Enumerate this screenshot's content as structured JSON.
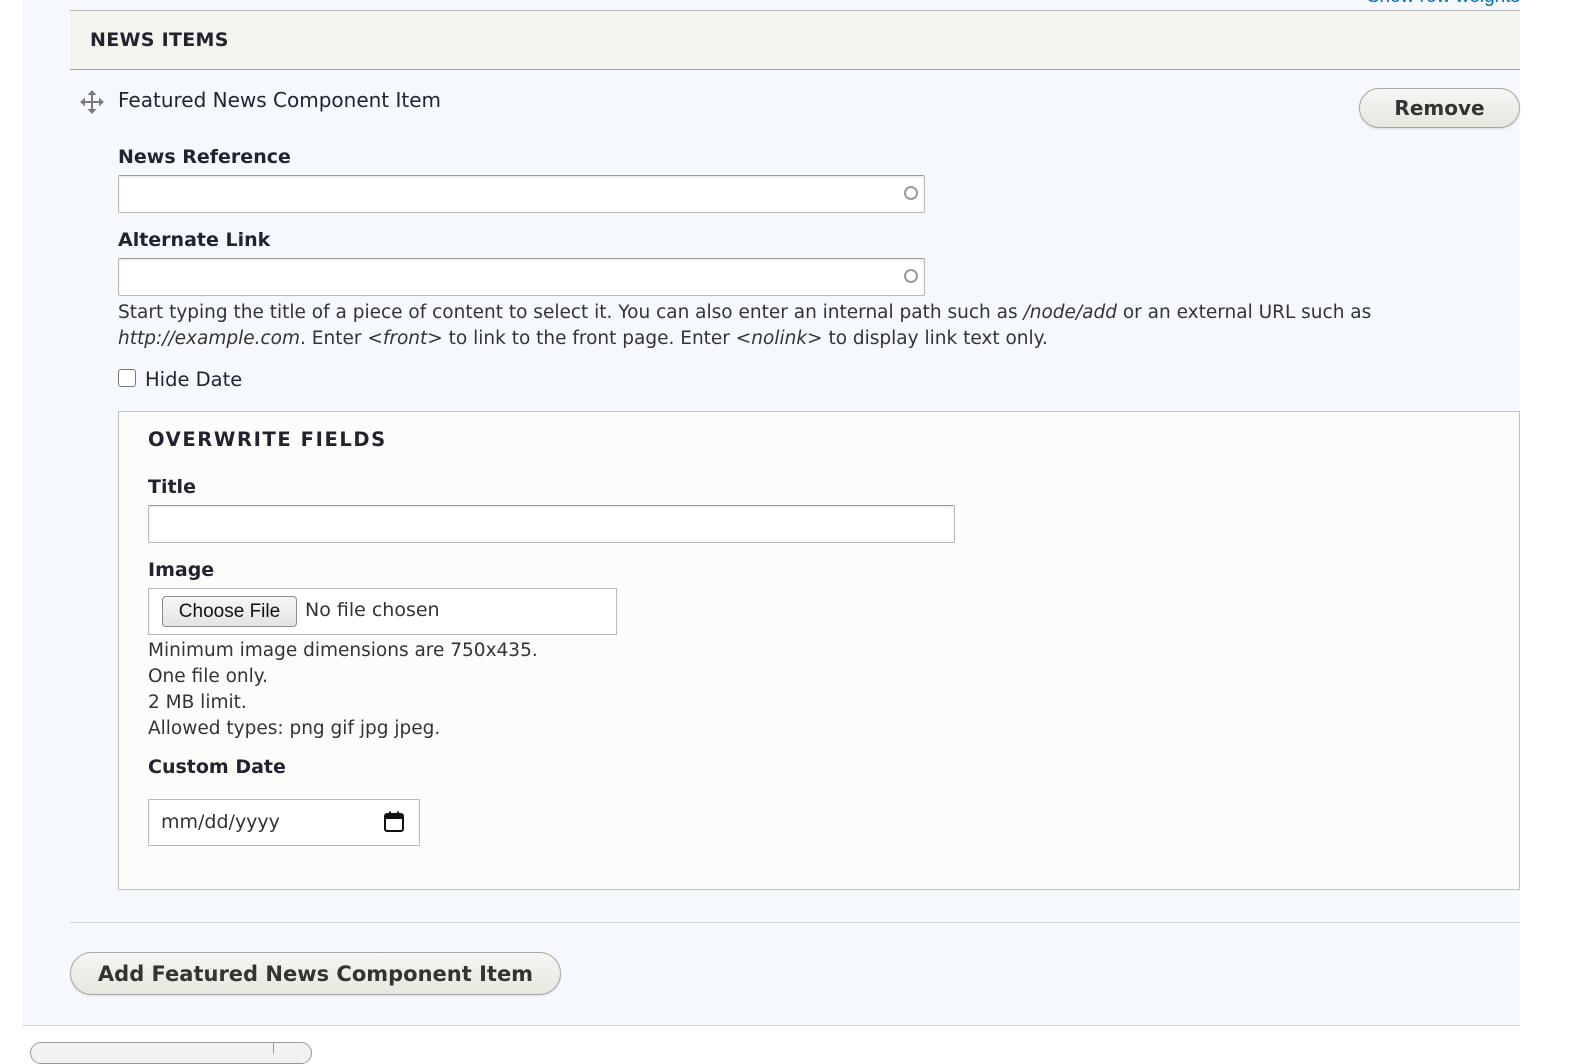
{
  "table": {
    "show_row_weights": "Show row weights",
    "header": "NEWS ITEMS"
  },
  "item": {
    "title": "Featured News Component Item",
    "remove_label": "Remove",
    "news_reference": {
      "label": "News Reference",
      "value": ""
    },
    "alternate_link": {
      "label": "Alternate Link",
      "value": "",
      "help": {
        "p1": "Start typing the title of a piece of content to select it. You can also enter an internal path such as ",
        "path": "/node/add",
        "p2": " or an external URL such as",
        "url": "http://example.com",
        "p3": ". Enter ",
        "front": "<front>",
        "p4": " to link to the front page. Enter ",
        "nolink": "<nolink>",
        "p5": " to display link text only."
      }
    },
    "hide_date": {
      "label": "Hide Date",
      "checked": false
    },
    "overwrite": {
      "legend": "OVERWRITE FIELDS",
      "title": {
        "label": "Title",
        "value": ""
      },
      "image": {
        "label": "Image",
        "choose_label": "Choose File",
        "status": "No file chosen",
        "help": [
          "Minimum image dimensions are 750x435.",
          "One file only.",
          "2 MB limit.",
          "Allowed types: png gif jpg jpeg."
        ]
      },
      "custom_date": {
        "label": "Custom Date",
        "placeholder": "mm/dd/yyyy",
        "icon": "calendar-icon"
      }
    }
  },
  "add_button_label": "Add Featured News Component Item",
  "icons": {
    "drag": "drag-handle-icon",
    "throbber": "autocomplete-throbber-icon"
  },
  "colors": {
    "link": "#0071b8",
    "panel_bg": "#f5f9fd",
    "header_bg": "#f3f4ee"
  }
}
